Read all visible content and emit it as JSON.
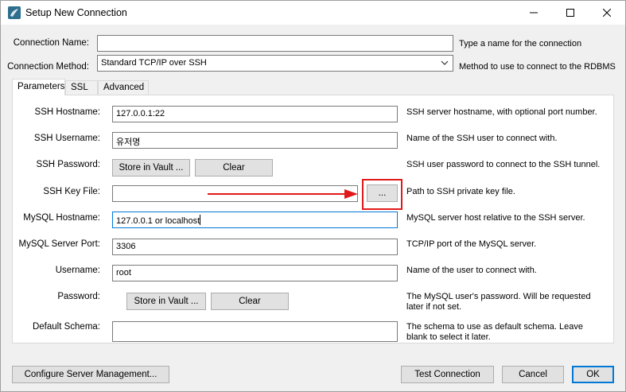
{
  "window": {
    "title": "Setup New Connection",
    "controls": {
      "minimize": "minimize",
      "maximize": "maximize",
      "close": "close"
    }
  },
  "connection": {
    "name_label": "Connection Name:",
    "name_value": "",
    "name_hint": "Type a name for the connection",
    "method_label": "Connection Method:",
    "method_value": "Standard TCP/IP over SSH",
    "method_hint": "Method to use to connect to the RDBMS"
  },
  "tabs": [
    {
      "label": "Parameters",
      "active": true
    },
    {
      "label": "SSL",
      "active": false
    },
    {
      "label": "Advanced",
      "active": false
    }
  ],
  "params": {
    "ssh_hostname": {
      "label": "SSH Hostname:",
      "value": "127.0.0.1:22",
      "hint": "SSH server hostname, with  optional port number."
    },
    "ssh_username": {
      "label": "SSH Username:",
      "value": "유저명",
      "hint": "Name of the SSH user to connect with."
    },
    "ssh_password": {
      "label": "SSH Password:",
      "store_label": "Store in Vault ...",
      "clear_label": "Clear",
      "hint": "SSH user password to connect to the SSH tunnel."
    },
    "ssh_key_file": {
      "label": "SSH Key File:",
      "value": "",
      "browse_label": "...",
      "hint": "Path to SSH private key file."
    },
    "mysql_hostname": {
      "label": "MySQL Hostname:",
      "value": "127.0.0.1  or localhost",
      "hint": "MySQL server host relative to the SSH server."
    },
    "mysql_port": {
      "label": "MySQL Server Port:",
      "value": "3306",
      "hint": "TCP/IP port of the MySQL server."
    },
    "username": {
      "label": "Username:",
      "value": "root",
      "hint": "Name of the user to connect with."
    },
    "password": {
      "label": "Password:",
      "store_label": "Store in Vault ...",
      "clear_label": "Clear",
      "hint_line1": "The MySQL user's password. Will be requested",
      "hint_line2": "later if not set."
    },
    "default_schema": {
      "label": "Default Schema:",
      "value": "",
      "hint_line1": "The schema to use as default schema. Leave",
      "hint_line2": "blank to select it later."
    }
  },
  "footer": {
    "configure_label": "Configure Server Management...",
    "test_label": "Test Connection",
    "cancel_label": "Cancel",
    "ok_label": "OK"
  },
  "colors": {
    "annotation": "#e11919",
    "focus": "#0078d7"
  }
}
